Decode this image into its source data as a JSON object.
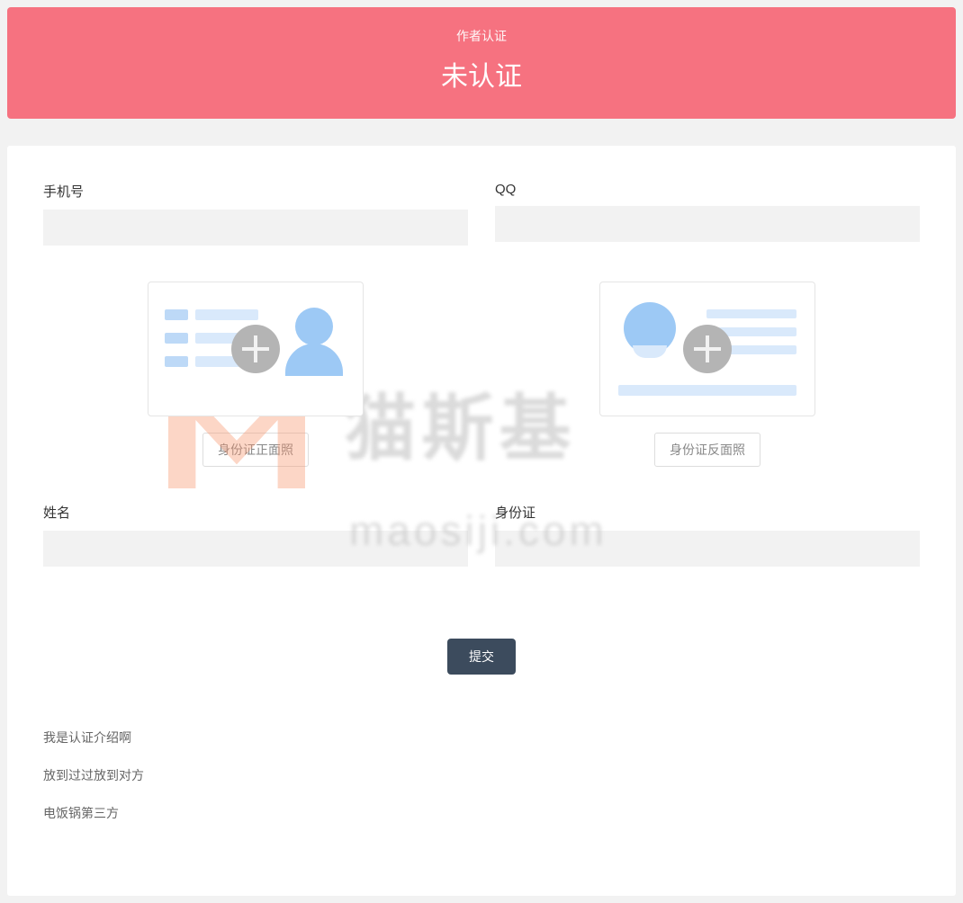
{
  "header": {
    "subtitle": "作者认证",
    "title": "未认证"
  },
  "form": {
    "phone": {
      "label": "手机号",
      "value": ""
    },
    "qq": {
      "label": "QQ",
      "value": ""
    },
    "name": {
      "label": "姓名",
      "value": ""
    },
    "idnum": {
      "label": "身份证",
      "value": ""
    },
    "id_front_button": "身份证正面照",
    "id_back_button": "身份证反面照",
    "submit": "提交"
  },
  "notes": [
    "我是认证介绍啊",
    "放到过过放到对方",
    "电饭锅第三方"
  ],
  "watermark": {
    "cn": "猫斯基",
    "en": "maosiji.com"
  }
}
